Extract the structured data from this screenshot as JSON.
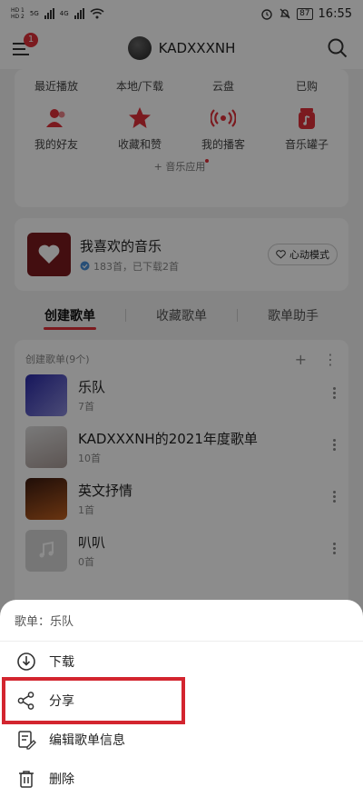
{
  "status": {
    "network_top": "HD 1",
    "network_bottom": "HD 2",
    "sig1": "5G",
    "sig2": "4G",
    "battery": "87",
    "time": "16:55"
  },
  "header": {
    "username": "KADXXXNH",
    "menu_badge": "1"
  },
  "shortcuts": {
    "top": [
      "最近播放",
      "本地/下载",
      "云盘",
      "已购"
    ],
    "main": [
      "我的好友",
      "收藏和赞",
      "我的播客",
      "音乐罐子"
    ],
    "apps_label": "+ 音乐应用"
  },
  "favorites": {
    "title": "我喜欢的音乐",
    "subtitle": "183首，已下载2首",
    "mode_button": "心动模式"
  },
  "tabs": [
    "创建歌单",
    "收藏歌单",
    "歌单助手"
  ],
  "playlists": {
    "header": "创建歌单(9个)",
    "items": [
      {
        "name": "乐队",
        "count": "7首"
      },
      {
        "name": "KADXXXNH的2021年度歌单",
        "count": "10首"
      },
      {
        "name": "英文抒情",
        "count": "1首"
      },
      {
        "name": "叭叭",
        "count": "0首"
      }
    ]
  },
  "sheet": {
    "title": "歌单：乐队",
    "items": [
      "下载",
      "分享",
      "编辑歌单信息",
      "删除"
    ]
  },
  "colors": {
    "accent": "#e0303a",
    "highlight": "#d3252f"
  }
}
